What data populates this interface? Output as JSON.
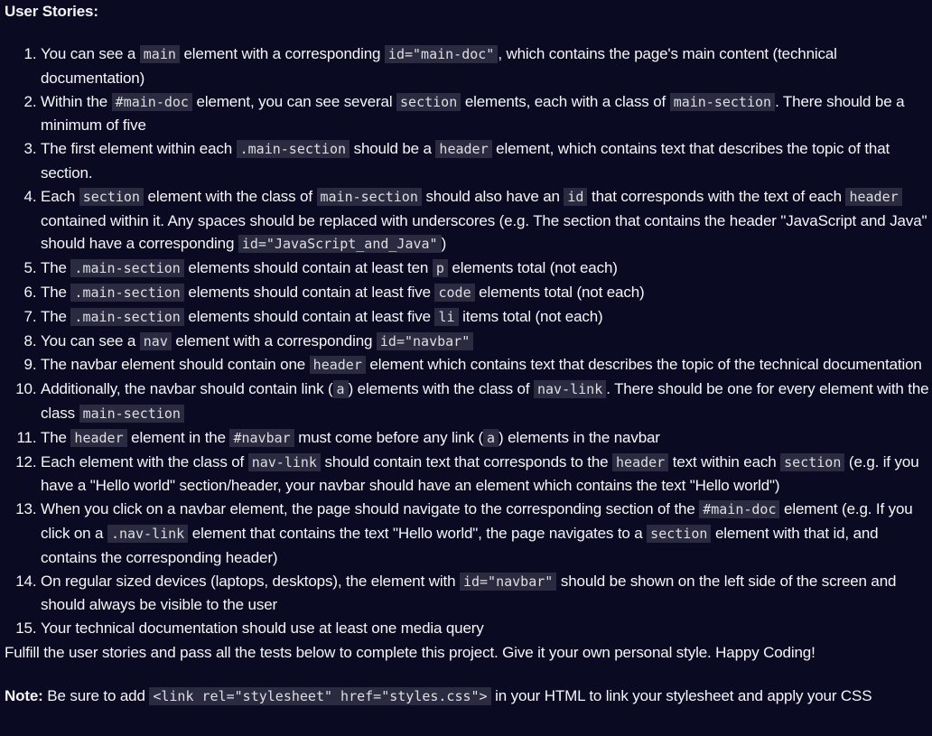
{
  "heading": "User Stories:",
  "stories": [
    [
      "You can see a ",
      {
        "c": "main"
      },
      " element with a corresponding ",
      {
        "c": "id=\"main-doc\""
      },
      ", which contains the page's main content (technical documentation)"
    ],
    [
      "Within the ",
      {
        "c": "#main-doc"
      },
      " element, you can see several ",
      {
        "c": "section"
      },
      " elements, each with a class of ",
      {
        "c": "main-section"
      },
      ". There should be a minimum of five"
    ],
    [
      "The first element within each ",
      {
        "c": ".main-section"
      },
      " should be a ",
      {
        "c": "header"
      },
      " element, which contains text that describes the topic of that section."
    ],
    [
      "Each ",
      {
        "c": "section"
      },
      " element with the class of ",
      {
        "c": "main-section"
      },
      " should also have an ",
      {
        "c": "id"
      },
      " that corresponds with the text of each ",
      {
        "c": "header"
      },
      " contained within it. Any spaces should be replaced with underscores (e.g. The section that contains the header \"JavaScript and Java\" should have a corresponding ",
      {
        "c": "id=\"JavaScript_and_Java\""
      },
      ")"
    ],
    [
      "The ",
      {
        "c": ".main-section"
      },
      " elements should contain at least ten ",
      {
        "c": "p"
      },
      " elements total (not each)"
    ],
    [
      "The ",
      {
        "c": ".main-section"
      },
      " elements should contain at least five ",
      {
        "c": "code"
      },
      " elements total (not each)"
    ],
    [
      "The ",
      {
        "c": ".main-section"
      },
      " elements should contain at least five ",
      {
        "c": "li"
      },
      " items total (not each)"
    ],
    [
      "You can see a ",
      {
        "c": "nav"
      },
      " element with a corresponding ",
      {
        "c": "id=\"navbar\""
      }
    ],
    [
      "The navbar element should contain one ",
      {
        "c": "header"
      },
      " element which contains text that describes the topic of the technical documentation"
    ],
    [
      "Additionally, the navbar should contain link (",
      {
        "c": "a"
      },
      ") elements with the class of ",
      {
        "c": "nav-link"
      },
      ". There should be one for every element with the class ",
      {
        "c": "main-section"
      }
    ],
    [
      "The ",
      {
        "c": "header"
      },
      " element in the ",
      {
        "c": "#navbar"
      },
      " must come before any link (",
      {
        "c": "a"
      },
      ") elements in the navbar"
    ],
    [
      "Each element with the class of ",
      {
        "c": "nav-link"
      },
      " should contain text that corresponds to the ",
      {
        "c": "header"
      },
      " text within each ",
      {
        "c": "section"
      },
      " (e.g. if you have a \"Hello world\" section/header, your navbar should have an element which contains the text \"Hello world\")"
    ],
    [
      "When you click on a navbar element, the page should navigate to the corresponding section of the ",
      {
        "c": "#main-doc"
      },
      " element (e.g. If you click on a ",
      {
        "c": ".nav-link"
      },
      " element that contains the text \"Hello world\", the page navigates to a ",
      {
        "c": "section"
      },
      " element with that id, and contains the corresponding header)"
    ],
    [
      "On regular sized devices (laptops, desktops), the element with ",
      {
        "c": "id=\"navbar\""
      },
      " should be shown on the left side of the screen and should always be visible to the user"
    ],
    [
      "Your technical documentation should use at least one media query"
    ]
  ],
  "fulfill": "Fulfill the user stories and pass all the tests below to complete this project. Give it your own personal style. Happy Coding!",
  "note": {
    "label": "Note:",
    "before": " Be sure to add ",
    "code": "<link rel=\"stylesheet\" href=\"styles.css\">",
    "after": " in your HTML to link your stylesheet and apply your CSS"
  }
}
